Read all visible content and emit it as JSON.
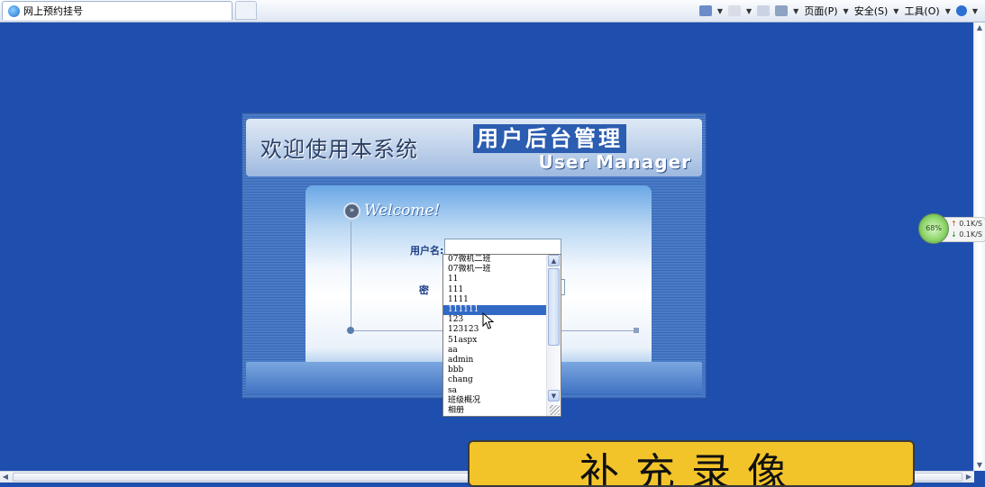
{
  "browser": {
    "tab_title": "网上预约挂号",
    "menu": {
      "page": "页面(P)",
      "safety": "安全(S)",
      "tools": "工具(O)"
    }
  },
  "network_widget": {
    "percent": "68%",
    "up_rate": "0.1K/S",
    "down_rate": "0.1K/S"
  },
  "login": {
    "welcome_cn": "欢迎使用本系统",
    "title_cn": "用户后台管理",
    "title_en": "User Manager",
    "welcome_badge": "Welcome!",
    "username_label": "用户名:",
    "password_label": "密 码"
  },
  "autocomplete": {
    "items": [
      "07微机二班",
      "07微机一班",
      "11",
      "111",
      "1111",
      "111111",
      "123",
      "123123",
      "51aspx",
      "aa",
      "admin",
      "bbb",
      "chang",
      "sa",
      "班级概况",
      "相册"
    ],
    "selected_index": 5
  },
  "overlay_banner": {
    "text": "补充录像"
  },
  "colors": {
    "page_background": "#1f4fae",
    "selection": "#316ac5",
    "banner_yellow": "#f3c42a"
  }
}
